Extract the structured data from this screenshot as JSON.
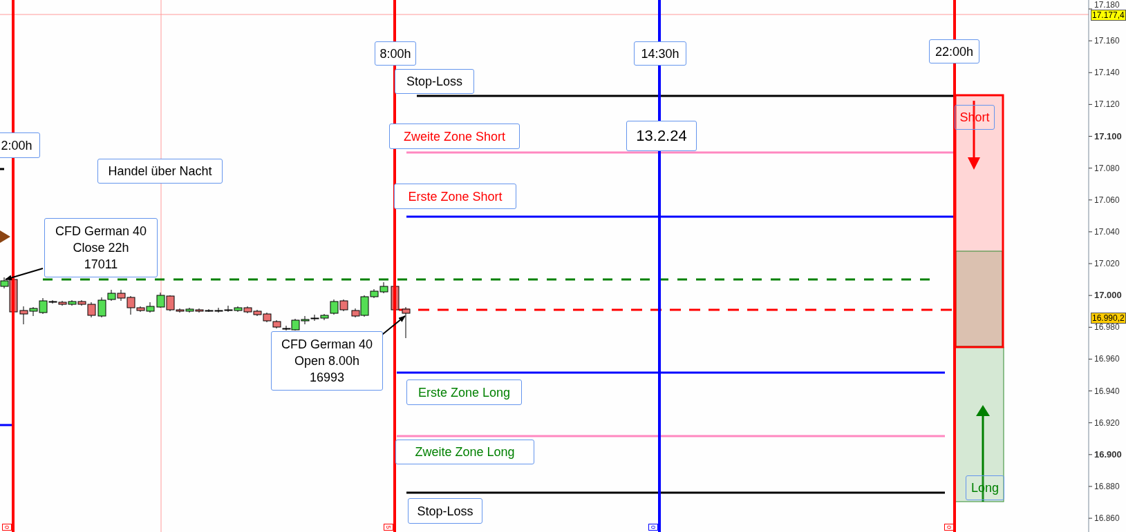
{
  "price_axis": {
    "ticks": [
      {
        "label": "17.180",
        "major": false
      },
      {
        "label": "17.160",
        "major": false
      },
      {
        "label": "17.140",
        "major": false
      },
      {
        "label": "17.120",
        "major": false
      },
      {
        "label": "17.100",
        "major": true
      },
      {
        "label": "17.080",
        "major": false
      },
      {
        "label": "17.060",
        "major": false
      },
      {
        "label": "17.040",
        "major": false
      },
      {
        "label": "17.020",
        "major": false
      },
      {
        "label": "17.000",
        "major": true
      },
      {
        "label": "16.980",
        "major": false
      },
      {
        "label": "16.960",
        "major": false
      },
      {
        "label": "16.940",
        "major": false
      },
      {
        "label": "16.920",
        "major": false
      },
      {
        "label": "16.900",
        "major": true
      },
      {
        "label": "16.880",
        "major": false
      },
      {
        "label": "16.860",
        "major": false
      }
    ],
    "markers": [
      {
        "label": "17.177,4",
        "kind": "high"
      },
      {
        "label": "16.990,2",
        "kind": "last"
      }
    ]
  },
  "time_labels": [
    {
      "text": "2:00h"
    },
    {
      "text": "8:00h"
    },
    {
      "text": "14:30h"
    },
    {
      "text": "22:00h"
    }
  ],
  "notes": [
    {
      "lines": [
        "Handel über Nacht"
      ]
    },
    {
      "lines": [
        "CFD German 40",
        "Close 22h",
        "17011"
      ]
    },
    {
      "lines": [
        "CFD German 40",
        "Open 8.00h",
        "16993"
      ]
    },
    {
      "lines": [
        "13.2.24"
      ]
    }
  ],
  "levels": [
    {
      "label": "Stop-Loss",
      "color": "#000000"
    },
    {
      "label": "Zweite Zone Short",
      "color": "#ff0000"
    },
    {
      "label": "Erste Zone Short",
      "color": "#ff0000"
    },
    {
      "label": "Erste Zone Long",
      "color": "#008000"
    },
    {
      "label": "Zweite Zone Long",
      "color": "#008000"
    },
    {
      "label": "Stop-Loss",
      "color": "#000000"
    }
  ],
  "zones": [
    {
      "label": "Short",
      "color": "#ff0000"
    },
    {
      "label": "Long",
      "color": "#008000"
    }
  ],
  "session_ticks": [
    "0",
    "5",
    "0",
    "0"
  ]
}
